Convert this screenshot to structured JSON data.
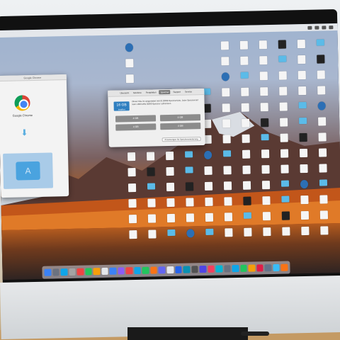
{
  "chrome_window": {
    "title": "Google Chrome",
    "app_label": "Google Chrome"
  },
  "about_mac": {
    "tabs": [
      "Übersicht",
      "Monitore",
      "Festplatten",
      "Speicher",
      "Support",
      "Service"
    ],
    "active_tab_index": 3,
    "memory_size": "16 GB",
    "memory_sub": "installiert",
    "memory_desc": "Dieser Mac ist ausgestattet mit (4) DDR3-Speicherslots. Jeder Speicherslot kann 1600 MHz DDR3-Speicher aufnehmen.",
    "slots": [
      "4 GB",
      "4 GB",
      "4 GB",
      "4 GB"
    ],
    "upgrade_button": "Anweisungen für Speichererweiterung"
  },
  "desktop": {
    "icon_types": [
      "app",
      "folder",
      "doc",
      "doc",
      "doc",
      "doc",
      "doc",
      "doc",
      "dark",
      "doc",
      "folder",
      "doc",
      "doc",
      "doc",
      "doc",
      "doc",
      "doc",
      "doc",
      "doc",
      "folder",
      "doc",
      "dark",
      "doc",
      "doc",
      "doc",
      "doc",
      "folder"
    ]
  },
  "dock": {
    "icon_colors": [
      "#3b82f6",
      "#6b7280",
      "#0ea5e9",
      "#a3a3a3",
      "#ef4444",
      "#22c55e",
      "#f59e0b",
      "#e5e7eb",
      "#3b82f6",
      "#8b5cf6",
      "#ef4444",
      "#0ea5e9",
      "#22c55e",
      "#f97316",
      "#6366f1",
      "#e5e7eb",
      "#2563eb",
      "#0891b2",
      "#525252",
      "#4f46e5",
      "#f43f5e",
      "#06b6d4",
      "#6b7280",
      "#0ea5e9",
      "#22c55e",
      "#f59e0b",
      "#e11d48",
      "#64748b",
      "#38bdf8",
      "#f97316"
    ]
  }
}
